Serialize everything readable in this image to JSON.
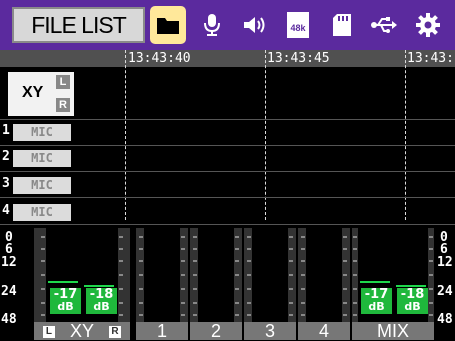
{
  "toolbar": {
    "file_list_label": "FILE LIST",
    "icons": [
      "folder-icon",
      "microphone-icon",
      "speaker-icon",
      "sample-rate-icon",
      "sd-card-icon",
      "usb-icon",
      "gear-icon"
    ],
    "sample_rate_label": "48k",
    "active_icon": "folder-icon"
  },
  "timeline": {
    "markers": [
      "13:43:40",
      "13:43:45",
      "13:43:"
    ]
  },
  "tracks": {
    "xy": {
      "label": "XY",
      "left": "L",
      "right": "R"
    },
    "channels": [
      {
        "number": "1",
        "label": "MIC"
      },
      {
        "number": "2",
        "label": "MIC"
      },
      {
        "number": "3",
        "label": "MIC"
      },
      {
        "number": "4",
        "label": "MIC"
      }
    ]
  },
  "meters": {
    "scale": [
      "0",
      "6",
      "12",
      "24",
      "48"
    ],
    "xy_levels": [
      {
        "value": "-17",
        "unit": "dB"
      },
      {
        "value": "-18",
        "unit": "dB"
      }
    ],
    "mix_levels": [
      {
        "value": "-17",
        "unit": "dB"
      },
      {
        "value": "-18",
        "unit": "dB"
      }
    ],
    "bottom_labels": {
      "xy": "XY",
      "xy_left": "L",
      "xy_right": "R",
      "ch1": "1",
      "ch2": "2",
      "ch3": "3",
      "ch4": "4",
      "mix": "MIX"
    }
  },
  "colors": {
    "toolbar": "#5b2a9e",
    "active_icon_bg": "#ffe89a",
    "level_green": "#1fb83c"
  }
}
